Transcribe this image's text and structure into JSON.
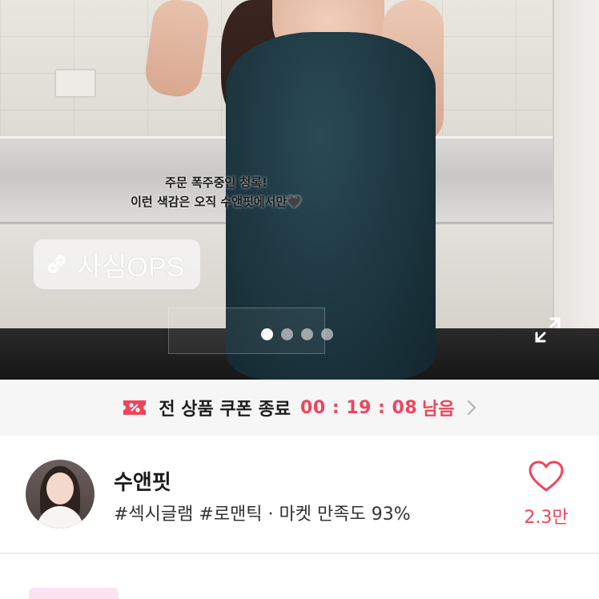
{
  "hero": {
    "promo_line1": "주문 폭주중인 청록!",
    "promo_line2": "이런 색감은 오직 수앤핏에서만🖤",
    "product_chip": "사심OPS",
    "carousel": {
      "total": 4,
      "active_index": 0
    }
  },
  "coupon": {
    "label": "전 상품 쿠폰 종료",
    "timer": "00 : 19 : 08",
    "suffix": "남음",
    "accent_color": "#f0445c"
  },
  "shop": {
    "name": "수앤핏",
    "tags": "#섹시글램 #로맨틱 · 마켓 만족도 93%",
    "like_count": "2.3만"
  },
  "icons": {
    "link": "link-icon",
    "expand": "expand-icon",
    "coupon": "coupon-icon",
    "chevron": "chevron-right-icon",
    "heart": "heart-icon"
  }
}
